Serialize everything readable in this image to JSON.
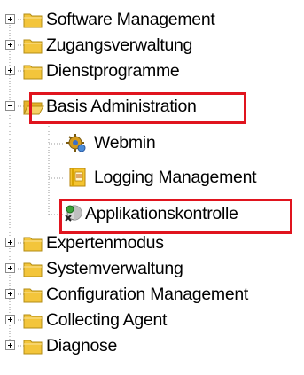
{
  "tree": {
    "items": [
      {
        "label": "Software Management"
      },
      {
        "label": "Zugangsverwaltung"
      },
      {
        "label": "Dienstprogramme"
      },
      {
        "label": "Basis Administration"
      },
      {
        "label": "Webmin"
      },
      {
        "label": "Logging Management"
      },
      {
        "label": "Applikationskontrolle"
      },
      {
        "label": "Expertenmodus"
      },
      {
        "label": "Systemverwaltung"
      },
      {
        "label": "Configuration Management"
      },
      {
        "label": "Collecting Agent"
      },
      {
        "label": "Diagnose"
      }
    ],
    "highlight_color": "#e0141e",
    "folder_color": "#f3c53b"
  }
}
